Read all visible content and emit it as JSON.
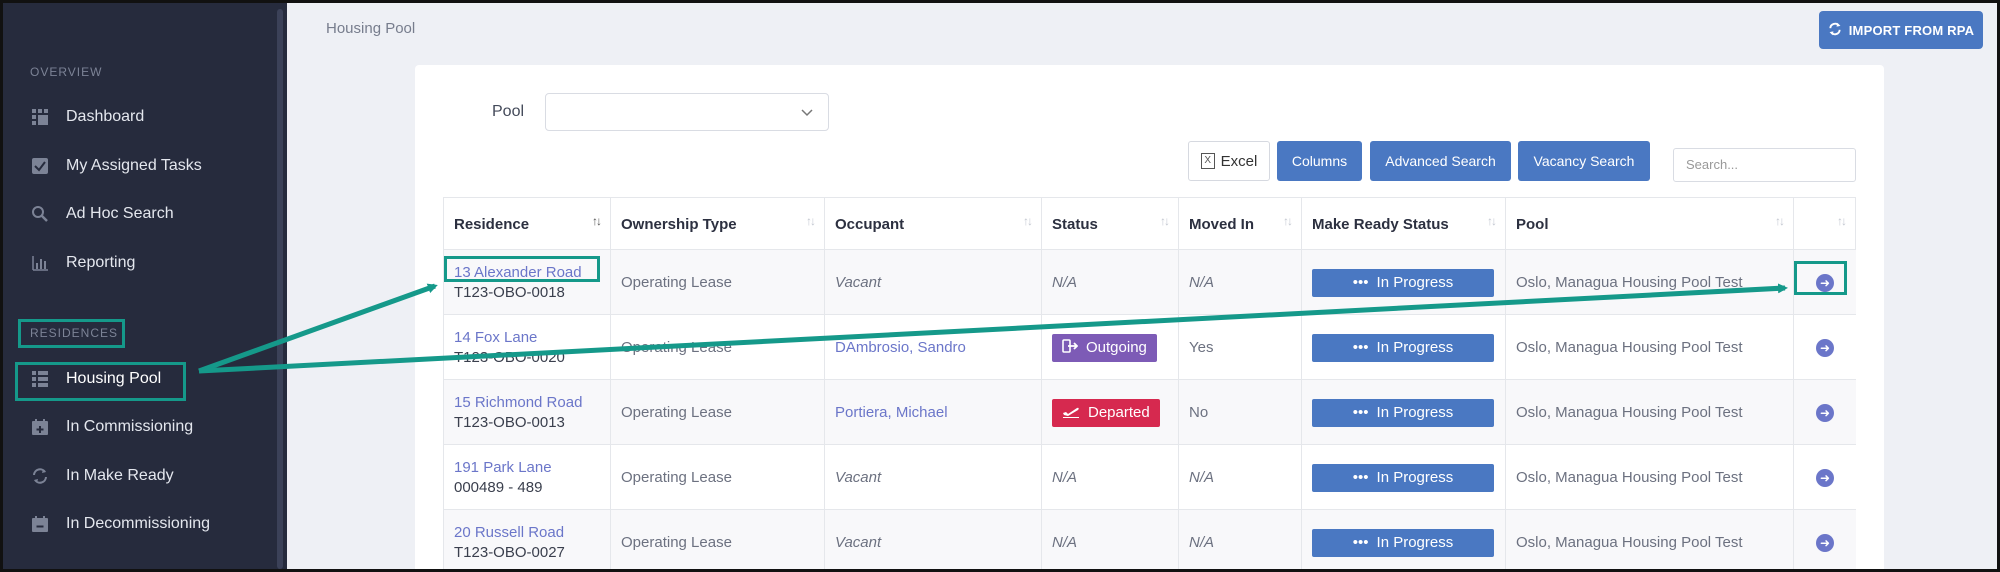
{
  "sidebar": {
    "overview_label": "OVERVIEW",
    "residences_label": "RESIDENCES",
    "overview_items": [
      {
        "label": "Dashboard",
        "icon": "dashboard-icon"
      },
      {
        "label": "My Assigned Tasks",
        "icon": "checkbox-icon"
      },
      {
        "label": "Ad Hoc Search",
        "icon": "search-icon"
      },
      {
        "label": "Reporting",
        "icon": "bar-chart-icon"
      }
    ],
    "residence_items": [
      {
        "label": "Housing Pool",
        "icon": "list-icon",
        "active": true
      },
      {
        "label": "In Commissioning",
        "icon": "calendar-plus-icon"
      },
      {
        "label": "In Make Ready",
        "icon": "refresh-icon"
      },
      {
        "label": "In Decommissioning",
        "icon": "calendar-minus-icon"
      }
    ]
  },
  "header": {
    "title": "Housing Pool",
    "import_button": "IMPORT FROM RPA"
  },
  "filters": {
    "pool_label": "Pool",
    "pool_value": ""
  },
  "toolbar": {
    "excel": "Excel",
    "columns": "Columns",
    "advanced_search": "Advanced Search",
    "vacancy_search": "Vacancy Search",
    "search_placeholder": "Search..."
  },
  "table": {
    "headers": [
      "Residence",
      "Ownership Type",
      "Occupant",
      "Status",
      "Moved In",
      "Make Ready Status",
      "Pool",
      ""
    ],
    "rows": [
      {
        "residence": "13 Alexander Road",
        "code": "T123-OBO-0018",
        "ownership": "Operating Lease",
        "occupant": "Vacant",
        "status": "N/A",
        "moved_in": "N/A",
        "make_ready": "In Progress",
        "pool": "Oslo, Managua Housing Pool Test"
      },
      {
        "residence": "14 Fox Lane",
        "code": "T123-OBO-0020",
        "ownership": "Operating Lease",
        "occupant": "DAmbrosio, Sandro",
        "status": "Outgoing",
        "moved_in": "Yes",
        "make_ready": "In Progress",
        "pool": "Oslo, Managua Housing Pool Test"
      },
      {
        "residence": "15 Richmond Road",
        "code": "T123-OBO-0013",
        "ownership": "Operating Lease",
        "occupant": "Portiera, Michael",
        "status": "Departed",
        "moved_in": "No",
        "make_ready": "In Progress",
        "pool": "Oslo, Managua Housing Pool Test"
      },
      {
        "residence": "191 Park Lane",
        "code": "000489 - 489",
        "ownership": "Operating Lease",
        "occupant": "Vacant",
        "status": "N/A",
        "moved_in": "N/A",
        "make_ready": "In Progress",
        "pool": "Oslo, Managua Housing Pool Test"
      },
      {
        "residence": "20 Russell Road",
        "code": "T123-OBO-0027",
        "ownership": "Operating Lease",
        "occupant": "Vacant",
        "status": "N/A",
        "moved_in": "N/A",
        "make_ready": "In Progress",
        "pool": "Oslo, Managua Housing Pool Test"
      }
    ]
  },
  "colors": {
    "sidebar_bg": "#262b3d",
    "accent_blue": "#4a78c2",
    "link": "#6b76c9",
    "outgoing": "#7d5bb6",
    "departed": "#d6294f",
    "annotation": "#15998a"
  }
}
